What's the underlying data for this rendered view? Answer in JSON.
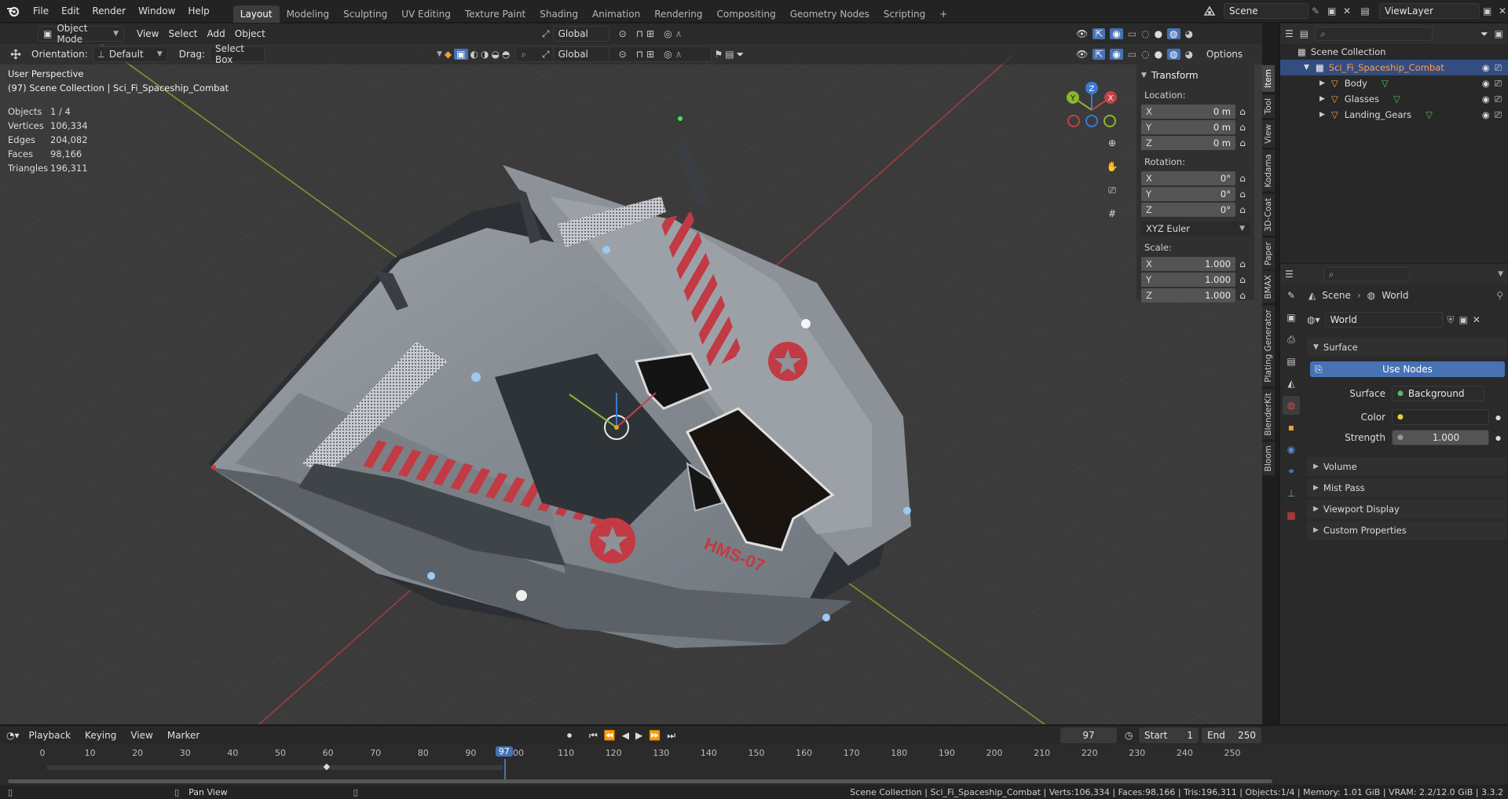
{
  "topbar": {
    "menus": [
      "File",
      "Edit",
      "Render",
      "Window",
      "Help"
    ],
    "workspaces": [
      "Layout",
      "Modeling",
      "Sculpting",
      "UV Editing",
      "Texture Paint",
      "Shading",
      "Animation",
      "Rendering",
      "Compositing",
      "Geometry Nodes",
      "Scripting"
    ],
    "active_workspace": "Layout",
    "add_tab": "+",
    "scene_value": "Scene",
    "view_layer_value": "ViewLayer"
  },
  "viewport_header": {
    "mode": "Object Mode",
    "menus": [
      "View",
      "Select",
      "Add",
      "Object"
    ],
    "transform_orientation": "Global",
    "options_label": "Options",
    "orientation_label": "Orientation:",
    "orientation_value": "Default",
    "drag_label": "Drag:",
    "drag_value": "Select Box"
  },
  "overlay": {
    "perspective": "User Perspective",
    "collection": "(97) Scene Collection | Sci_Fi_Spaceship_Combat",
    "stats": [
      {
        "k": "Objects",
        "v": "1 / 4"
      },
      {
        "k": "Vertices",
        "v": "106,334"
      },
      {
        "k": "Edges",
        "v": "204,082"
      },
      {
        "k": "Faces",
        "v": "98,166"
      },
      {
        "k": "Triangles",
        "v": "196,311"
      }
    ],
    "hull_text": "HMS-07"
  },
  "gizmo": {
    "x": "X",
    "y": "Y",
    "z": "Z"
  },
  "npanel": {
    "title": "Transform",
    "location_label": "Location:",
    "location": [
      {
        "ax": "X",
        "v": "0 m"
      },
      {
        "ax": "Y",
        "v": "0 m"
      },
      {
        "ax": "Z",
        "v": "0 m"
      }
    ],
    "rotation_label": "Rotation:",
    "rotation": [
      {
        "ax": "X",
        "v": "0°"
      },
      {
        "ax": "Y",
        "v": "0°"
      },
      {
        "ax": "Z",
        "v": "0°"
      }
    ],
    "rotation_mode": "XYZ Euler",
    "scale_label": "Scale:",
    "scale": [
      {
        "ax": "X",
        "v": "1.000"
      },
      {
        "ax": "Y",
        "v": "1.000"
      },
      {
        "ax": "Z",
        "v": "1.000"
      }
    ]
  },
  "sidetabs": [
    "Item",
    "Tool",
    "View",
    "Kodama",
    "3D-Coat",
    "Paper",
    "BMAX",
    "Plating Generator",
    "BlenderKit",
    "Bloom"
  ],
  "outliner": {
    "root": "Scene Collection",
    "collection": "Sci_Fi_Spaceship_Combat",
    "children": [
      "Body",
      "Glasses",
      "Landing_Gears"
    ]
  },
  "properties": {
    "breadcrumb_scene": "Scene",
    "breadcrumb_world": "World",
    "world_name": "World",
    "surface_panel": "Surface",
    "use_nodes": "Use Nodes",
    "surface_label": "Surface",
    "surface_value": "Background",
    "color_label": "Color",
    "strength_label": "Strength",
    "strength_value": "1.000",
    "panels": [
      "Volume",
      "Mist Pass",
      "Viewport Display",
      "Custom Properties"
    ]
  },
  "timeline": {
    "menus": [
      "Playback",
      "Keying",
      "View",
      "Marker"
    ],
    "current_frame": "97",
    "start_label": "Start",
    "start_value": "1",
    "end_label": "End",
    "end_value": "250",
    "ticks": [
      "0",
      "10",
      "20",
      "30",
      "40",
      "50",
      "60",
      "70",
      "80",
      "90",
      "00",
      "110",
      "120",
      "130",
      "140",
      "150",
      "160",
      "170",
      "180",
      "190",
      "200",
      "210",
      "220",
      "230",
      "240",
      "250"
    ]
  },
  "statusbar": {
    "hint": "Pan View",
    "info": "Scene Collection | Sci_Fi_Spaceship_Combat | Verts:106,334 | Faces:98,166 | Tris:196,311 | Objects:1/4 | Memory: 1.01 GiB | VRAM: 2.2/12.0 GiB | 3.3.2"
  },
  "colors": {
    "accent": "#4772b3",
    "selection": "#334d80",
    "x_axis": "#c4414a",
    "y_axis": "#8ab72f",
    "z_axis": "#3b79d6",
    "viewport_bg": "#393939"
  }
}
